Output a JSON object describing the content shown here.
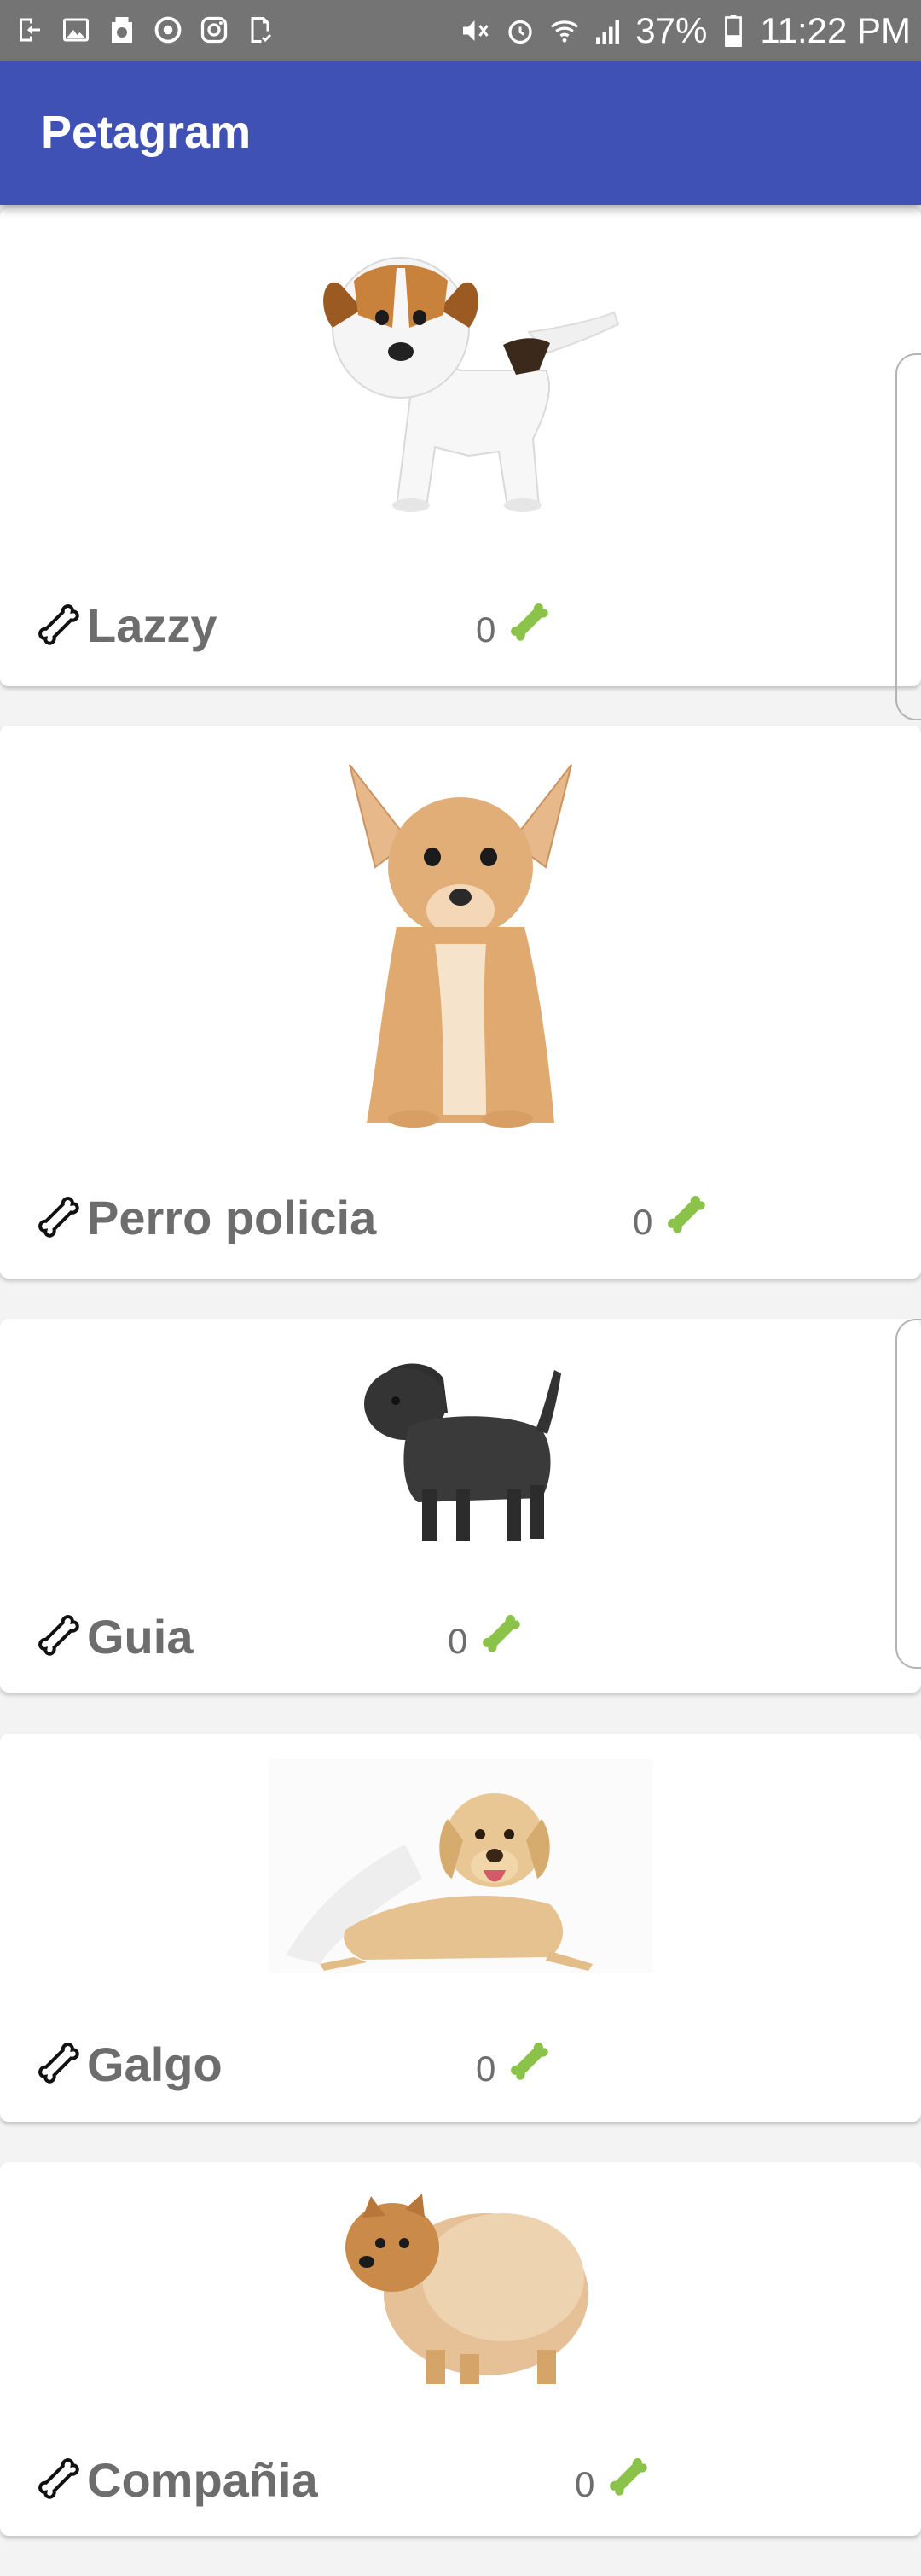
{
  "status_bar": {
    "battery": "37%",
    "time": "11:22 PM",
    "left_icons": [
      "exit-icon",
      "image-icon",
      "recycle-icon",
      "sync-icon",
      "instagram-icon",
      "doc-check-icon"
    ],
    "right_icons": [
      "mute-icon",
      "alarm-icon",
      "wifi-icon",
      "signal-icon",
      "battery-icon"
    ]
  },
  "app_bar": {
    "title": "Petagram",
    "color": "#3f51b5"
  },
  "pets": [
    {
      "name": "Lazzy",
      "likes": "0",
      "photo": "jack-russell-puppy"
    },
    {
      "name": "Perro policia",
      "likes": "0",
      "photo": "chihuahua"
    },
    {
      "name": "Guia",
      "likes": "0",
      "photo": "affenpinscher"
    },
    {
      "name": "Galgo",
      "likes": "0",
      "photo": "labrador"
    },
    {
      "name": "Compañia",
      "likes": "0",
      "photo": "pomeranian"
    }
  ],
  "colors": {
    "bone_green": "#8bc34a",
    "text_gray": "#6d6d6d"
  }
}
